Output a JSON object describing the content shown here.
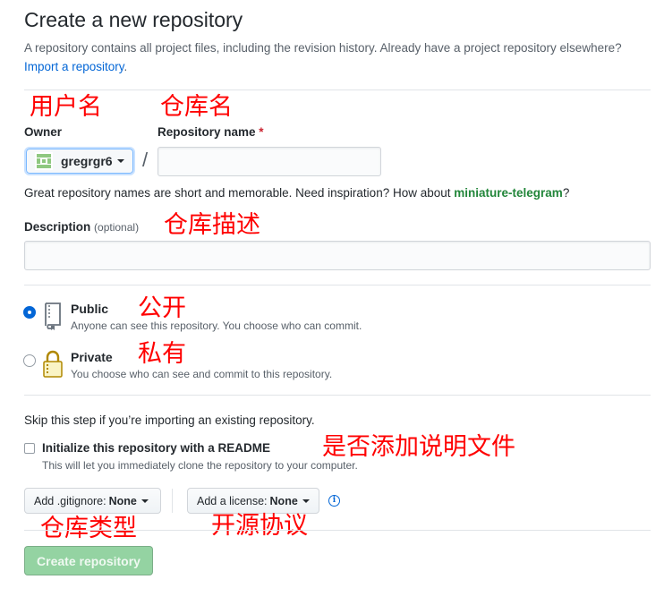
{
  "header": {
    "title": "Create a new repository",
    "subtitle": "A repository contains all project files, including the revision history. Already have a project repository elsewhere?",
    "import_link": "Import a repository",
    "subtitle_end": "."
  },
  "owner": {
    "label": "Owner",
    "value": "gregrgr6"
  },
  "repo_name": {
    "label": "Repository name",
    "required_mark": "*",
    "value": "",
    "separator": "/"
  },
  "name_hint": {
    "text": "Great repository names are short and memorable. Need inspiration? How about",
    "suggestion": "miniature-telegram",
    "end": "?"
  },
  "description": {
    "label": "Description",
    "optional": "(optional)",
    "value": ""
  },
  "visibility": {
    "selected": "public",
    "public": {
      "title": "Public",
      "desc": "Anyone can see this repository. You choose who can commit."
    },
    "private": {
      "title": "Private",
      "desc": "You choose who can see and commit to this repository."
    }
  },
  "init": {
    "skip_text": "Skip this step if you’re importing an existing repository.",
    "readme_label": "Initialize this repository with a README",
    "readme_desc": "This will let you immediately clone the repository to your computer.",
    "readme_checked": false
  },
  "gitignore": {
    "prefix": "Add .gitignore:",
    "value": "None"
  },
  "license": {
    "prefix": "Add a license:",
    "value": "None"
  },
  "submit": {
    "label": "Create repository"
  },
  "annotations": {
    "owner": "用户名",
    "repo_name": "仓库名",
    "description": "仓库描述",
    "public": "公开",
    "private": "私有",
    "readme": "是否添加说明文件",
    "gitignore": "仓库类型",
    "license": "开源协议"
  },
  "icons": {
    "owner_avatar": "identicon-avatar",
    "public": "repo-book-icon",
    "private": "lock-icon",
    "info": "info-icon",
    "dropdown": "caret-down-icon"
  },
  "colors": {
    "link": "#0366d6",
    "suggestion": "#22863a",
    "required": "#cb2431",
    "create_button": "#94d3a2",
    "annotation": "#ff0000"
  }
}
